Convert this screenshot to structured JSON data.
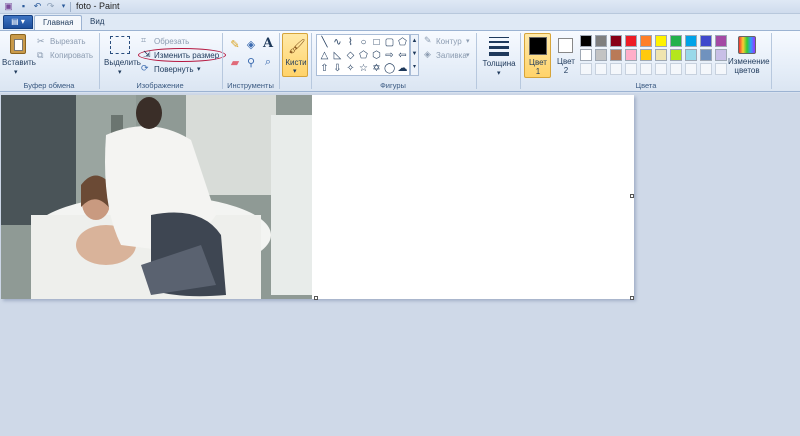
{
  "window": {
    "title": "foto - Paint"
  },
  "tabs": [
    {
      "label": "Главная"
    },
    {
      "label": "Вид"
    }
  ],
  "clipboard": {
    "paste": "Вставить",
    "cut": "Вырезать",
    "copy": "Копировать",
    "group": "Буфер обмена"
  },
  "image": {
    "select": "Выделить",
    "crop": "Обрезать",
    "resize": "Изменить размер",
    "rotate": "Повернуть",
    "group": "Изображение"
  },
  "tools": {
    "group": "Инструменты",
    "text_tool": "A"
  },
  "brushes": {
    "label": "Кисти"
  },
  "shapes": {
    "group": "Фигуры",
    "outline": "Контур",
    "fill": "Заливка"
  },
  "size": {
    "label": "Толщина"
  },
  "colors": {
    "color1": "Цвет 1",
    "color1_value": "#000000",
    "color2": "Цвет 2",
    "color2_value": "#ffffff",
    "edit": "Изменение цветов",
    "group": "Цвета",
    "palette_row1": [
      "#000000",
      "#7f7f7f",
      "#880015",
      "#ed1c24",
      "#ff7f27",
      "#fff200",
      "#22b14c",
      "#00a2e8",
      "#3f48cc",
      "#a349a4"
    ],
    "palette_row2": [
      "#ffffff",
      "#c3c3c3",
      "#b97a57",
      "#ffaec9",
      "#ffc90e",
      "#efe4b0",
      "#b5e61d",
      "#99d9ea",
      "#7092be",
      "#c8bfe7"
    ]
  },
  "canvas": {
    "background": "#ffffff"
  }
}
